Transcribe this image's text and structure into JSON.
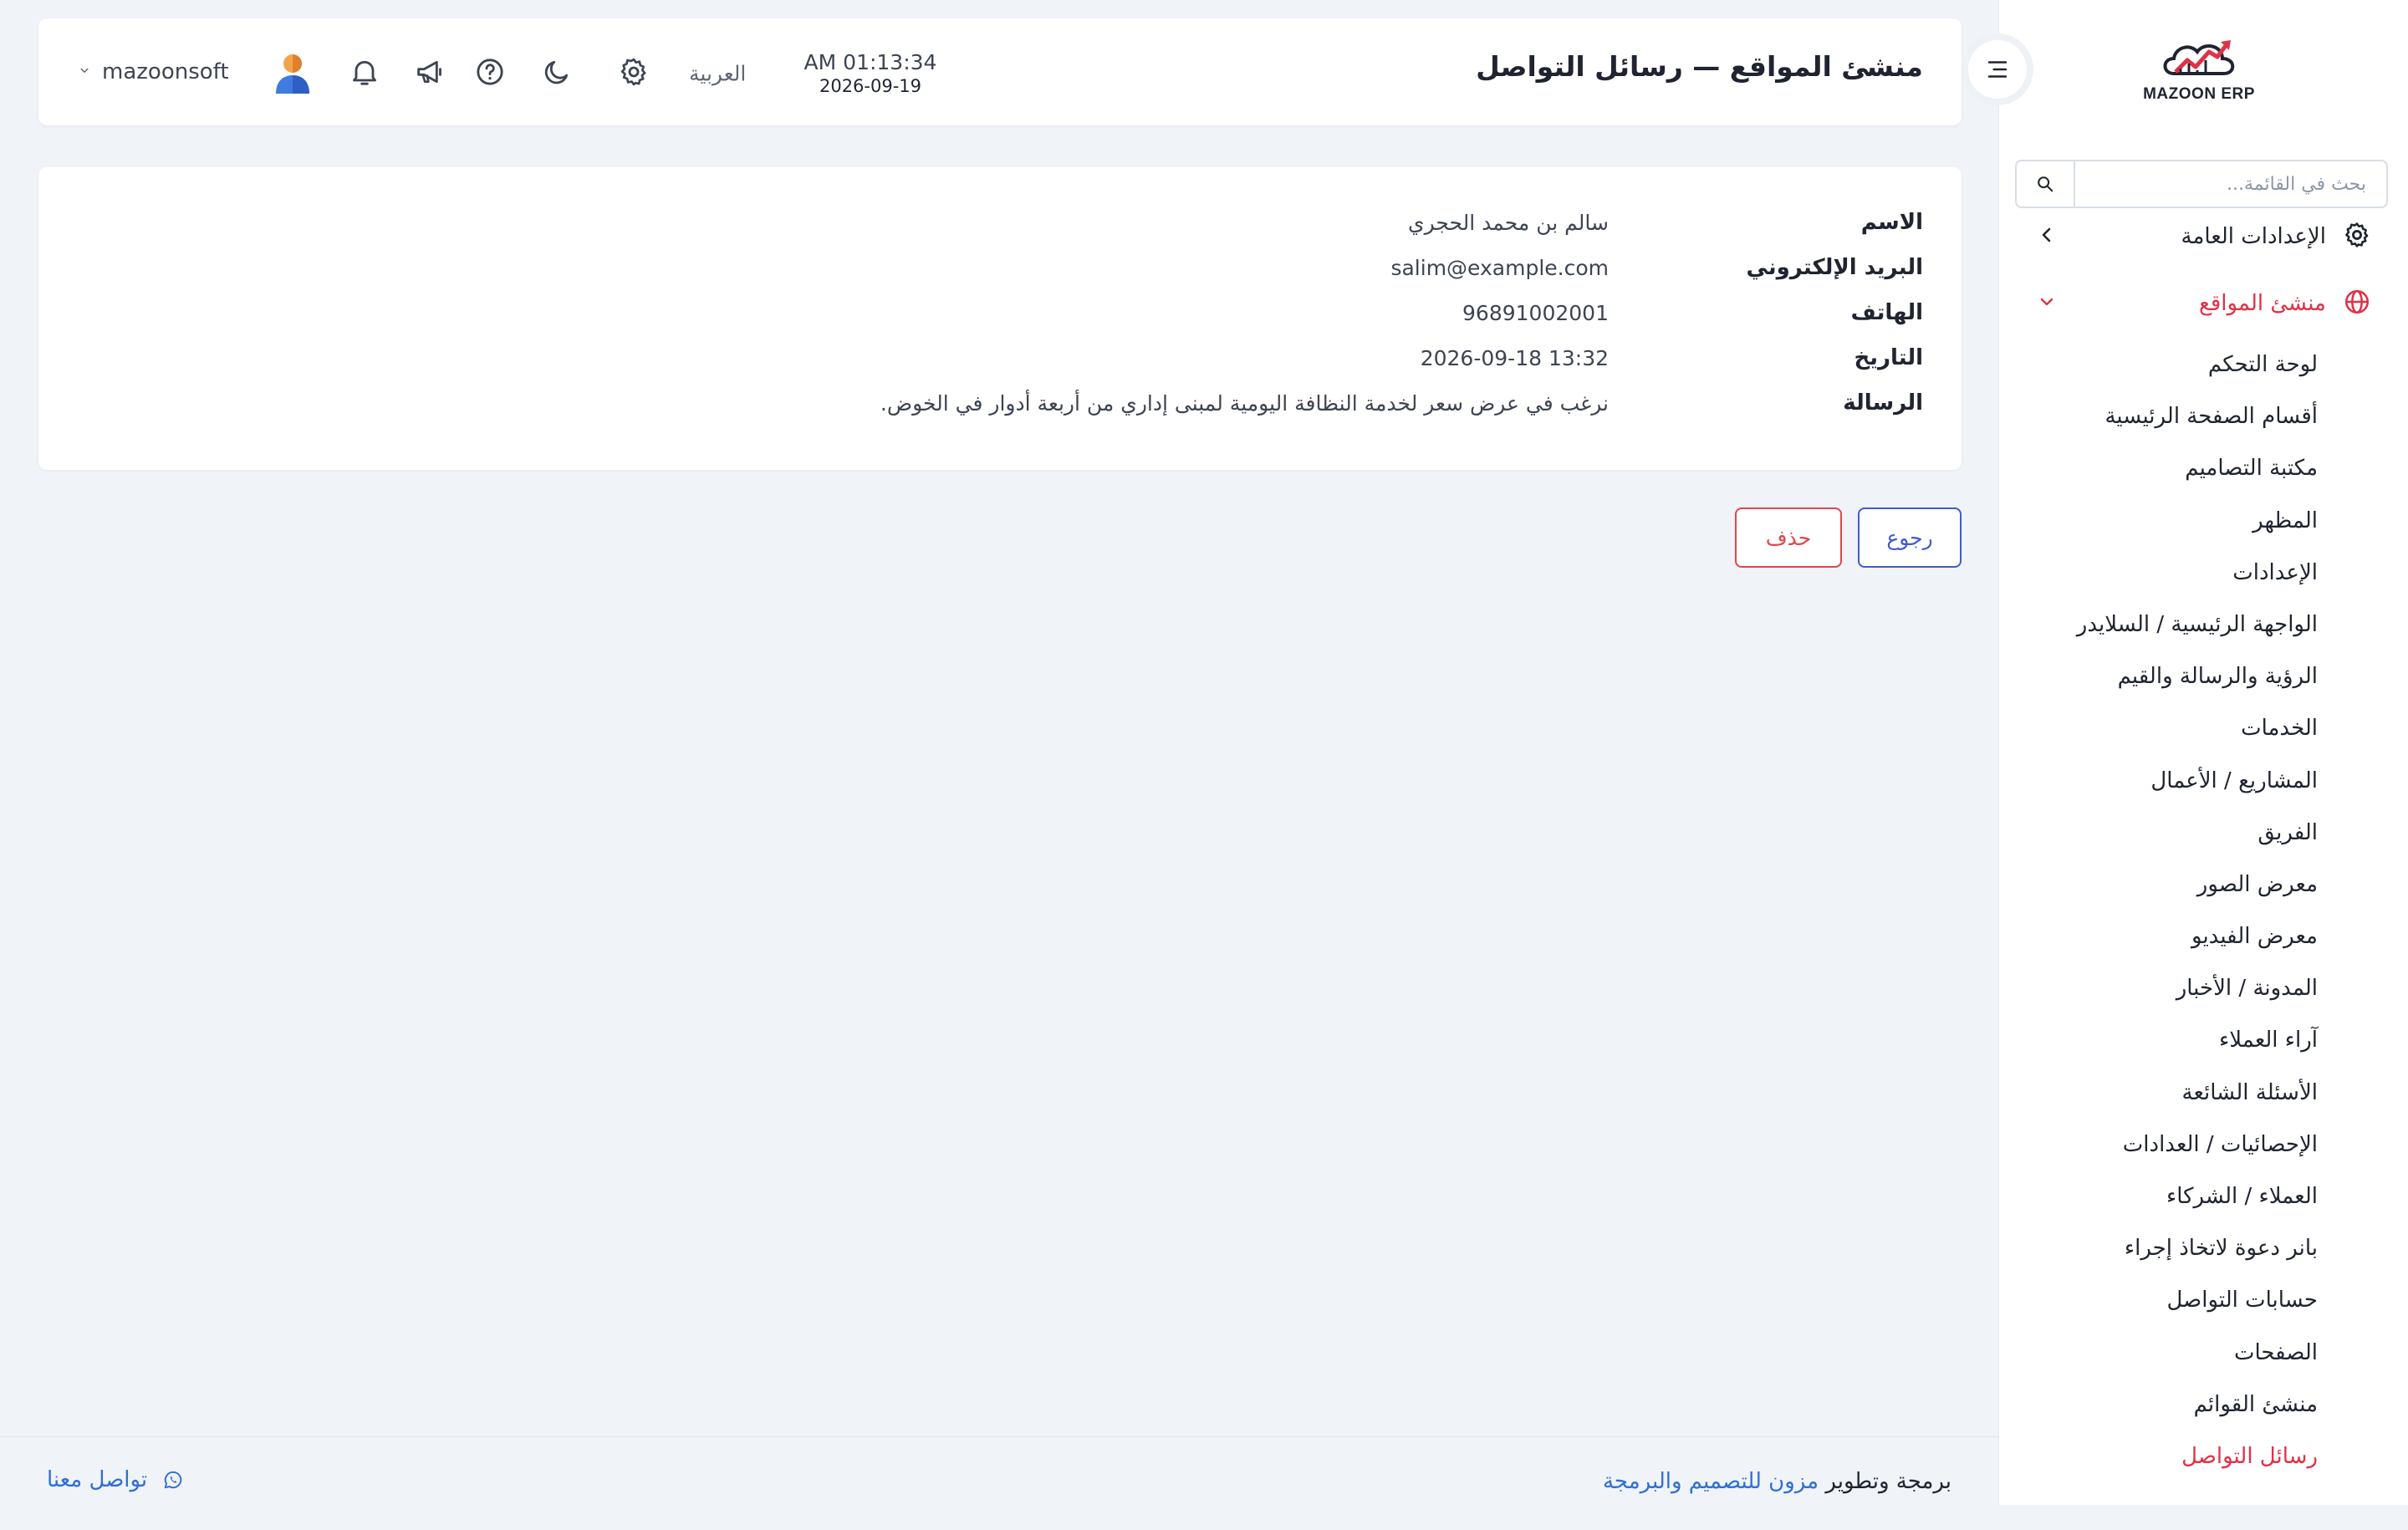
{
  "brand": {
    "name": "MAZOON ERP",
    "colors": {
      "accent": "#e03146",
      "primary": "#3f5bd1",
      "danger": "#e0464a",
      "link": "#2f6fd6"
    }
  },
  "sidebar": {
    "search_placeholder": "بحث في القائمة...",
    "groups": [
      {
        "label": "الإعدادات العامة",
        "icon": "gear-icon",
        "expanded": false
      },
      {
        "label": "منشئ المواقع",
        "icon": "globe-icon",
        "expanded": true
      }
    ],
    "items": [
      "لوحة التحكم",
      "أقسام الصفحة الرئيسية",
      "مكتبة التصاميم",
      "المظهر",
      "الإعدادات",
      "الواجهة الرئيسية / السلايدر",
      "الرؤية والرسالة والقيم",
      "الخدمات",
      "المشاريع / الأعمال",
      "الفريق",
      "معرض الصور",
      "معرض الفيديو",
      "المدونة / الأخبار",
      "آراء العملاء",
      "الأسئلة الشائعة",
      "الإحصائيات / العدادات",
      "العملاء / الشركاء",
      "بانر دعوة لاتخاذ إجراء",
      "حسابات التواصل",
      "الصفحات",
      "منشئ القوائم",
      "رسائل التواصل"
    ],
    "current_item": "رسائل التواصل"
  },
  "header": {
    "title": "منشئ المواقع — رسائل التواصل",
    "time": "AM 01:13:34",
    "date": "2026-09-19",
    "language": "العربية",
    "username": "mazoonsoft"
  },
  "message": {
    "fields": [
      {
        "label": "الاسم",
        "value": "سالم بن محمد الحجري",
        "ltr": false
      },
      {
        "label": "البريد الإلكتروني",
        "value": "salim@example.com",
        "ltr": true
      },
      {
        "label": "الهاتف",
        "value": "96891002001",
        "ltr": true
      },
      {
        "label": "التاريخ",
        "value": "2026-09-18 13:32",
        "ltr": true
      },
      {
        "label": "الرسالة",
        "value": "نرغب في عرض سعر لخدمة النظافة اليومية لمبنى إداري من أربعة أدوار في الخوض.",
        "ltr": false
      }
    ]
  },
  "actions": {
    "back_label": "رجوع",
    "delete_label": "حذف"
  },
  "footer": {
    "credit_prefix": "برمجة وتطوير",
    "credit_link": "مزون للتصميم والبرمجة",
    "contact_label": "تواصل معنا"
  }
}
